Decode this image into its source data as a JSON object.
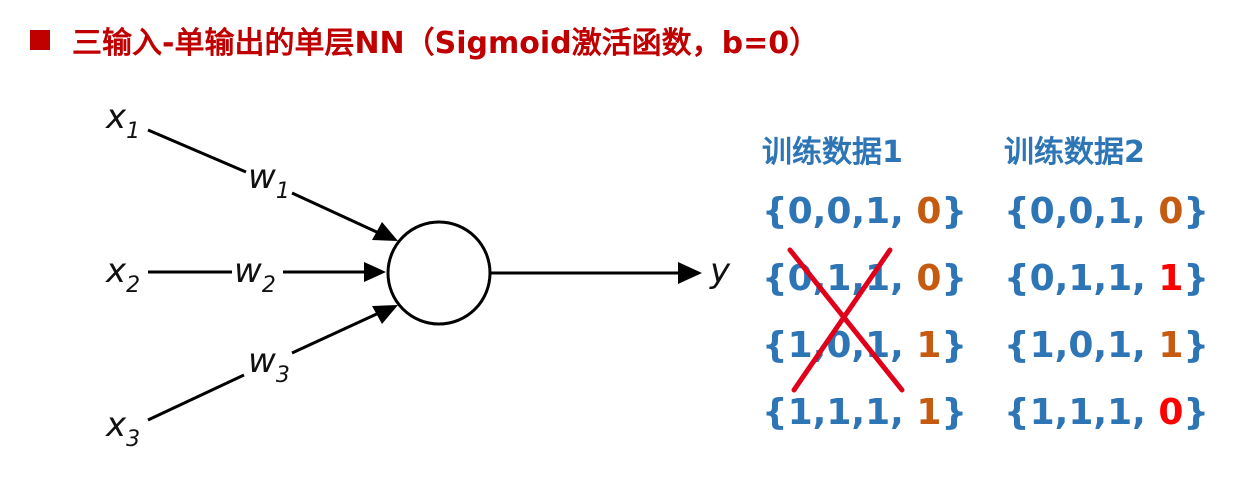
{
  "title": {
    "text": "三输入-单输出的单层NN（Sigmoid激活函数，b=0）"
  },
  "diagram": {
    "inputs": [
      "x",
      "x",
      "x"
    ],
    "input_subscripts": [
      "1",
      "2",
      "3"
    ],
    "weights": [
      "w",
      "w",
      "w"
    ],
    "weight_subscripts": [
      "1",
      "2",
      "3"
    ],
    "output": "y"
  },
  "tables": [
    {
      "heading": "训练数据1",
      "crossed_out": [
        1,
        2
      ],
      "rows": [
        {
          "inputs": "{0,0,1, ",
          "output": "0",
          "close": "}",
          "output_color": "orange"
        },
        {
          "inputs": "{0,1,1, ",
          "output": "0",
          "close": "}",
          "output_color": "orange"
        },
        {
          "inputs": "{1,0,1, ",
          "output": "1",
          "close": "}",
          "output_color": "orange"
        },
        {
          "inputs": "{1,1,1, ",
          "output": "1",
          "close": "}",
          "output_color": "orange"
        }
      ]
    },
    {
      "heading": "训练数据2",
      "crossed_out": [],
      "rows": [
        {
          "inputs": "{0,0,1, ",
          "output": "0",
          "close": "}",
          "output_color": "orange"
        },
        {
          "inputs": "{0,1,1, ",
          "output": "1",
          "close": "}",
          "output_color": "red"
        },
        {
          "inputs": "{1,0,1, ",
          "output": "1",
          "close": "}",
          "output_color": "orange"
        },
        {
          "inputs": "{1,1,1, ",
          "output": "0",
          "close": "}",
          "output_color": "red"
        }
      ]
    }
  ],
  "colors": {
    "title": "#c00000",
    "data_text": "#2e75b6",
    "output_orange": "#c55a11",
    "output_red": "#ff0000",
    "cross": "#e0001a"
  }
}
